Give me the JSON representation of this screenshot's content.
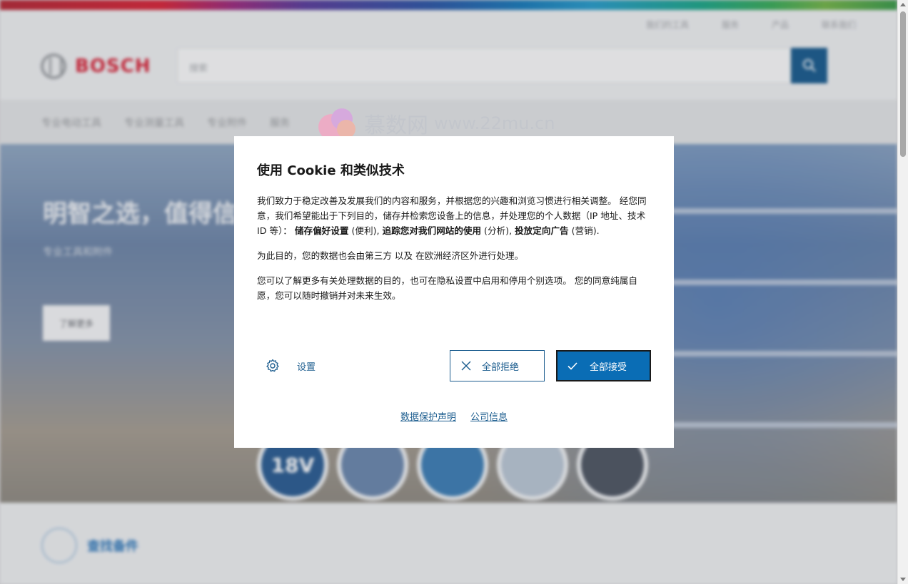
{
  "background": {
    "util_links": [
      "我们的工具",
      "服务",
      "产品",
      "联系我们"
    ],
    "logo_text": "BOSCH",
    "search_placeholder": "搜索",
    "nav_items": [
      "专业电动工具",
      "专业测量工具",
      "专业附件",
      "服务"
    ],
    "hero": {
      "title": "明智之选，值得信赖",
      "subtitle": "专业工具和附件",
      "button_label": "了解更多",
      "circle_label": "18V"
    },
    "below_section_label": "查找备件"
  },
  "watermark": {
    "brand": "慕数网",
    "url": "www.22mu.cn"
  },
  "cookie_dialog": {
    "title": "使用 Cookie 和类似技术",
    "p1_a": "我们致力于稳定改善及发展我们的内容和服务，并根据您的兴趣和浏览习惯进行相关调整。 经您同意，我们希望能出于下列目的，储存并检索您设备上的信息，并处理您的个人数据（IP 地址、技术 ID 等）：",
    "p1_b1": "储存偏好设置",
    "p1_c1": " (便利), ",
    "p1_b2": "追踪您对我们网站的使用",
    "p1_c2": " (分析), ",
    "p1_b3": "投放定向广告",
    "p1_c3": " (营销).",
    "p2": "为此目的，您的数据也会由第三方 以及 在欧洲经济区外进行处理。",
    "p3": "您可以了解更多有关处理数据的目的，也可在隐私设置中启用和停用个别选项。 您的同意纯属自愿，您可以随时撤销并对未来生效。",
    "settings_label": "设置",
    "reject_label": "全部拒绝",
    "accept_label": "全部接受",
    "links": {
      "privacy": "数据保护声明",
      "imprint": "公司信息"
    }
  },
  "colors": {
    "brand_blue": "#1c5d8f",
    "accept_blue": "#0a6db5",
    "bosch_red": "#d6283c"
  }
}
